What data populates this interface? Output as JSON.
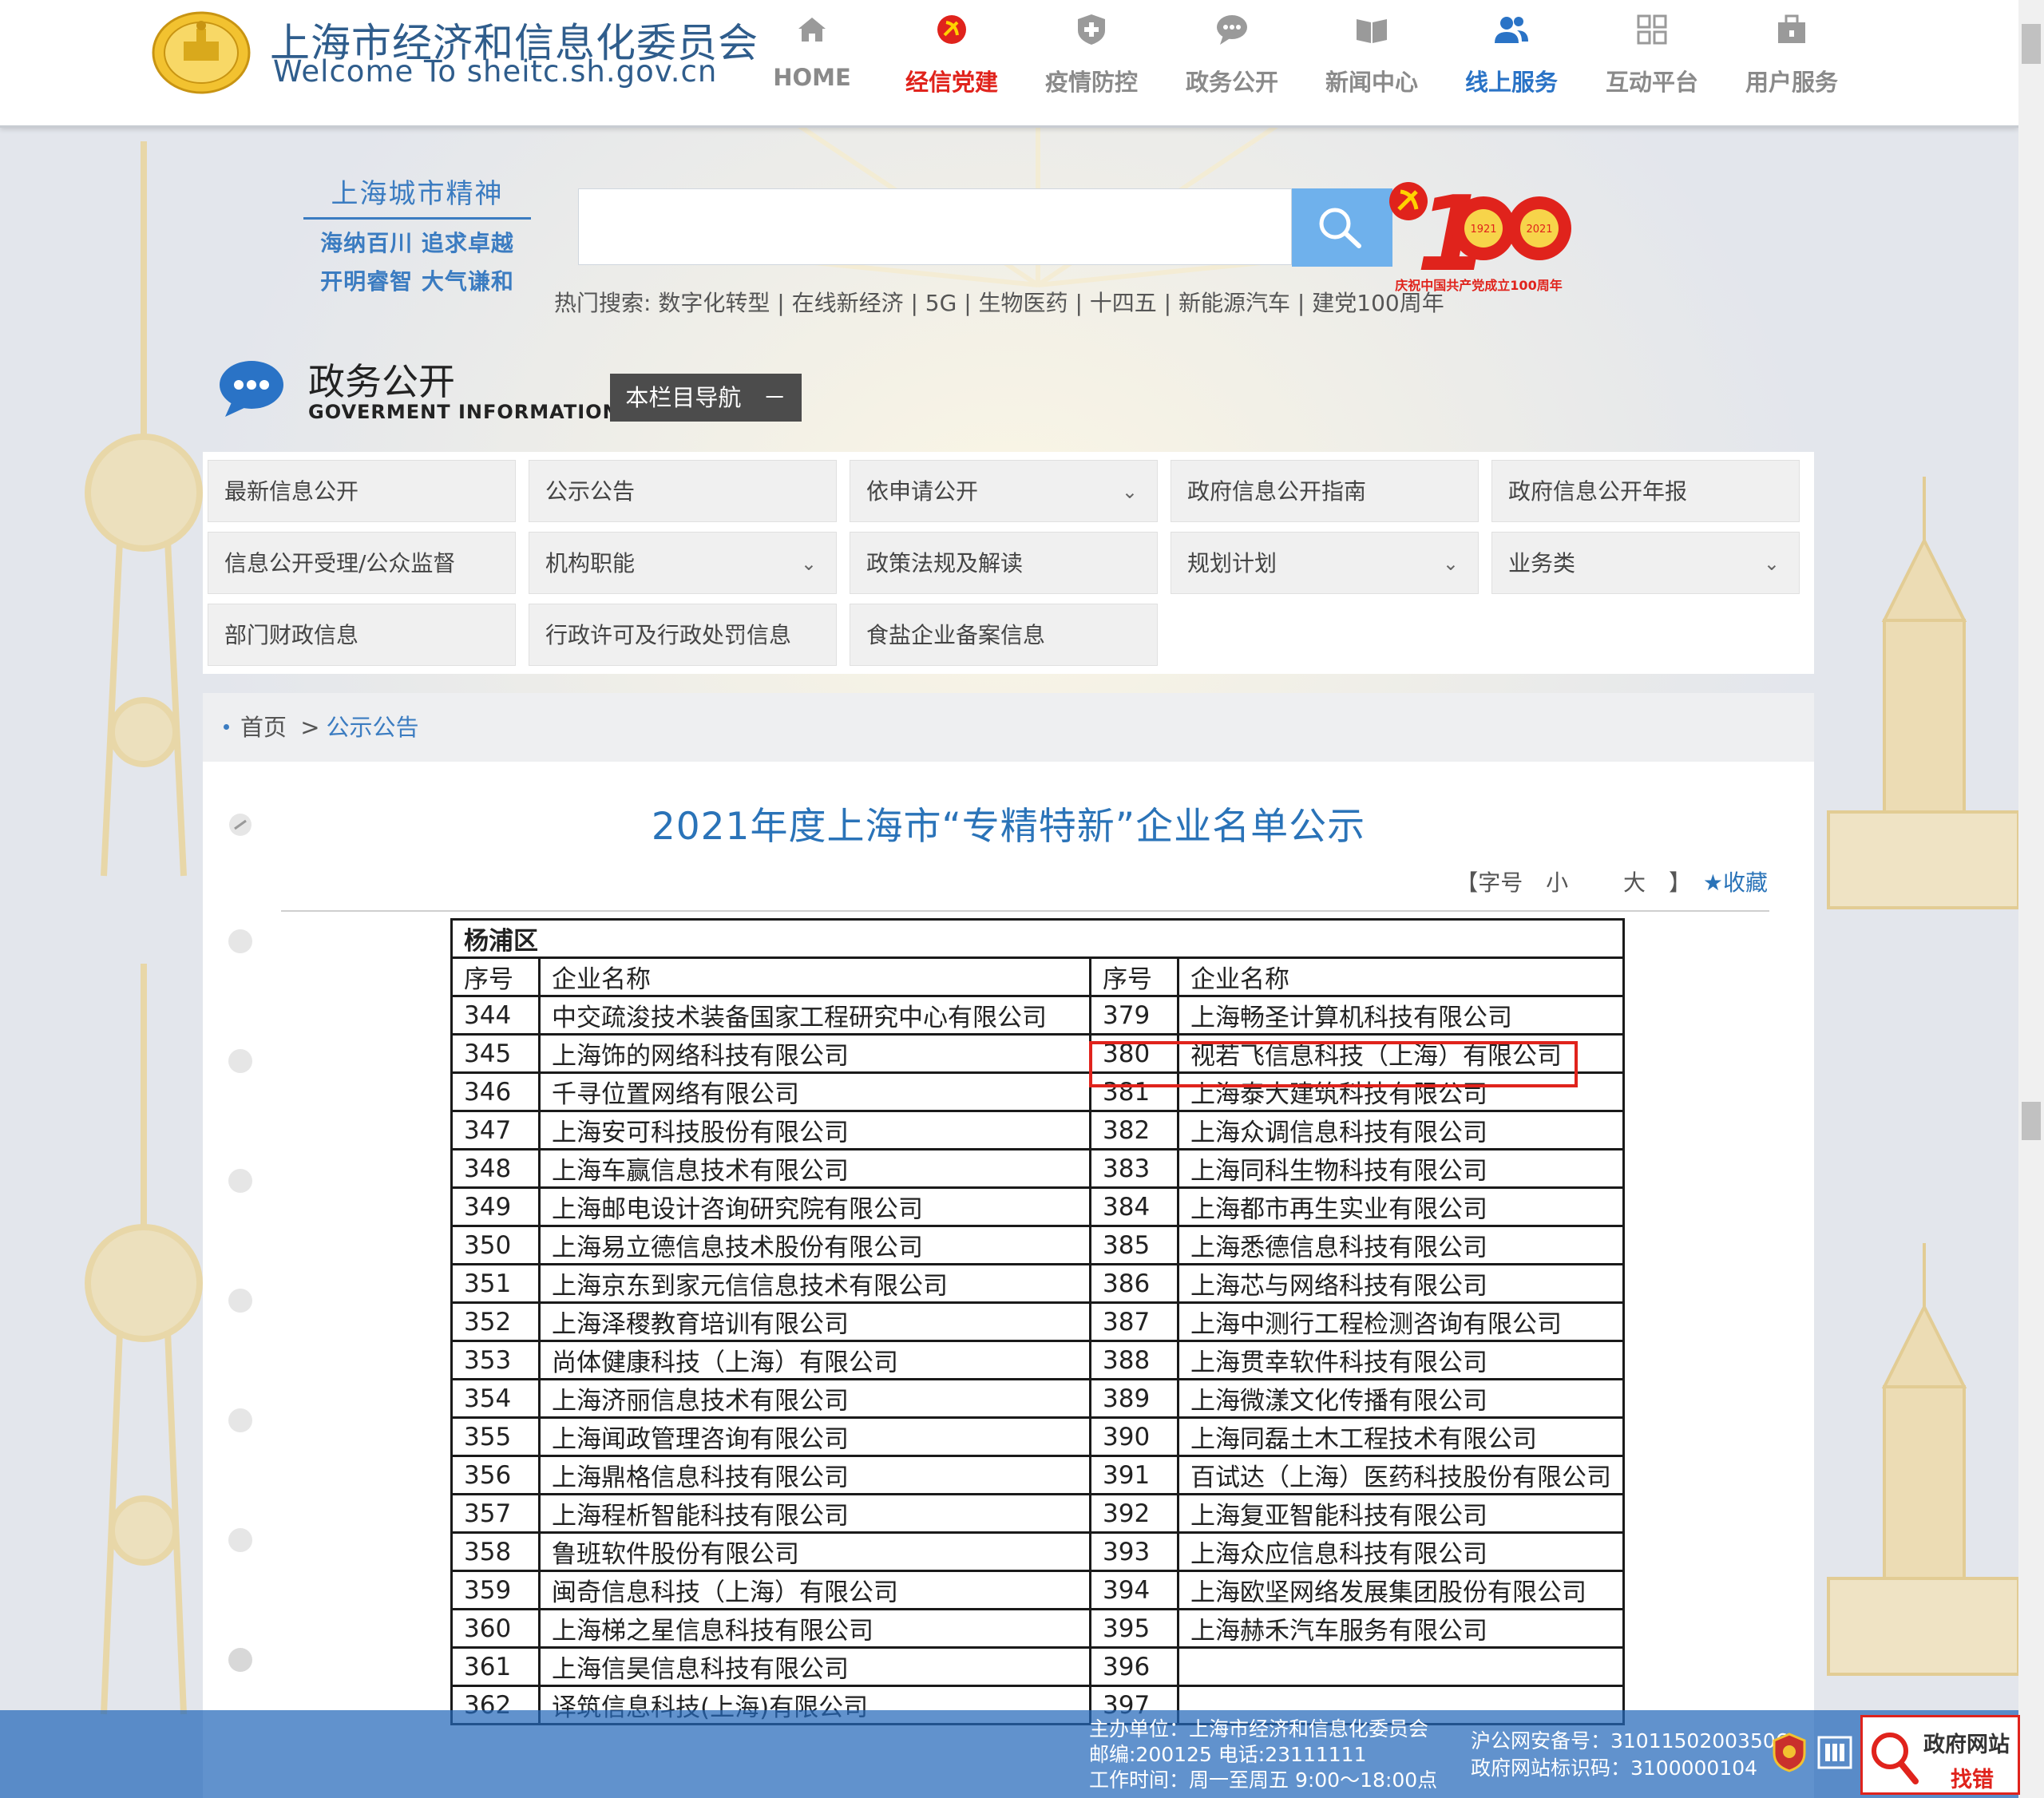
{
  "header": {
    "site_title": "上海市经济和信息化委员会",
    "site_subtitle": "Welcome To sheitc.sh.gov.cn",
    "nav": [
      {
        "label": "HOME",
        "icon": "home-icon"
      },
      {
        "label": "经信党建",
        "icon": "party-emblem-icon",
        "color": "#e0231c"
      },
      {
        "label": "疫情防控",
        "icon": "shield-cross-icon"
      },
      {
        "label": "政务公开",
        "icon": "chat-bubble-icon"
      },
      {
        "label": "新闻中心",
        "icon": "open-book-icon"
      },
      {
        "label": "线上服务",
        "icon": "users-icon",
        "color": "#2a73c6"
      },
      {
        "label": "互动平台",
        "icon": "grid-icon"
      },
      {
        "label": "用户服务",
        "icon": "briefcase-icon"
      }
    ]
  },
  "spirit": {
    "title": "上海城市精神",
    "line1": "海纳百川 追求卓越",
    "line2": "开明睿智 大气谦和"
  },
  "search": {
    "placeholder": "",
    "hot_search": "热门搜索: 数字化转型 | 在线新经济 | 5G | 生物医药 | 十四五 | 新能源汽车 | 建党100周年"
  },
  "anniversary_badge": {
    "text": "庆祝中国共产党成立100周年",
    "years": [
      "1921",
      "2021"
    ]
  },
  "section": {
    "title": "政务公开",
    "subtitle": "GOVERMENT INFORMATION",
    "column_nav_label": "本栏目导航",
    "column_nav_toggle": "－"
  },
  "menu": [
    {
      "label": "最新信息公开",
      "has_dropdown": false
    },
    {
      "label": "公示公告",
      "has_dropdown": false
    },
    {
      "label": "依申请公开",
      "has_dropdown": true
    },
    {
      "label": "政府信息公开指南",
      "has_dropdown": false
    },
    {
      "label": "政府信息公开年报",
      "has_dropdown": false
    },
    {
      "label": "信息公开受理/公众监督",
      "has_dropdown": false
    },
    {
      "label": "机构职能",
      "has_dropdown": true
    },
    {
      "label": "政策法规及解读",
      "has_dropdown": false
    },
    {
      "label": "规划计划",
      "has_dropdown": true
    },
    {
      "label": "业务类",
      "has_dropdown": true
    },
    {
      "label": "部门财政信息",
      "has_dropdown": false
    },
    {
      "label": "行政许可及行政处罚信息",
      "has_dropdown": false
    },
    {
      "label": "食盐企业备案信息",
      "has_dropdown": false
    }
  ],
  "breadcrumb": {
    "home": "首页",
    "separator": ">",
    "current": "公示公告"
  },
  "article": {
    "title": "2021年度上海市“专精特新”企业名单公示",
    "font_size_label": "【字号",
    "font_small": "小",
    "font_large": "大",
    "font_close": "】",
    "collect_label": "★收藏"
  },
  "table": {
    "district": "杨浦区",
    "headers": [
      "序号",
      "企业名称",
      "序号",
      "企业名称"
    ],
    "highlighted_no": "380",
    "rows": [
      [
        "344",
        "中交疏浚技术装备国家工程研究中心有限公司",
        "379",
        "上海畅圣计算机科技有限公司"
      ],
      [
        "345",
        "上海饰的网络科技有限公司",
        "380",
        "视若飞信息科技（上海）有限公司"
      ],
      [
        "346",
        "千寻位置网络有限公司",
        "381",
        "上海泰大建筑科技有限公司"
      ],
      [
        "347",
        "上海安可科技股份有限公司",
        "382",
        "上海众调信息科技有限公司"
      ],
      [
        "348",
        "上海车赢信息技术有限公司",
        "383",
        "上海同科生物科技有限公司"
      ],
      [
        "349",
        "上海邮电设计咨询研究院有限公司",
        "384",
        "上海都市再生实业有限公司"
      ],
      [
        "350",
        "上海易立德信息技术股份有限公司",
        "385",
        "上海悉德信息科技有限公司"
      ],
      [
        "351",
        "上海京东到家元信信息技术有限公司",
        "386",
        "上海芯与网络科技有限公司"
      ],
      [
        "352",
        "上海泽稷教育培训有限公司",
        "387",
        "上海中测行工程检测咨询有限公司"
      ],
      [
        "353",
        "尚体健康科技（上海）有限公司",
        "388",
        "上海贯幸软件科技有限公司"
      ],
      [
        "354",
        "上海济丽信息技术有限公司",
        "389",
        "上海微漾文化传播有限公司"
      ],
      [
        "355",
        "上海闻政管理咨询有限公司",
        "390",
        "上海同磊土木工程技术有限公司"
      ],
      [
        "356",
        "上海鼎格信息科技有限公司",
        "391",
        "百试达（上海）医药科技股份有限公司"
      ],
      [
        "357",
        "上海程析智能科技有限公司",
        "392",
        "上海复亚智能科技有限公司"
      ],
      [
        "358",
        "鲁班软件股份有限公司",
        "393",
        "上海众应信息科技有限公司"
      ],
      [
        "359",
        "闽奇信息科技（上海）有限公司",
        "394",
        "上海欧坚网络发展集团股份有限公司"
      ],
      [
        "360",
        "上海梯之星信息科技有限公司",
        "395",
        "上海赫禾汽车服务有限公司"
      ],
      [
        "361",
        "上海信昊信息科技有限公司",
        "396",
        ""
      ],
      [
        "362",
        "译筑信息科技(上海)有限公司",
        "397",
        ""
      ]
    ]
  },
  "footer": {
    "host_line": "主办单位：上海市经济和信息化委员会",
    "postal_line": "邮编:200125 电话:23111111",
    "hours_line": "工作时间：周一至周五 9:00～18:00点",
    "icp": "沪公网安备号：31011502003506",
    "site_id": "政府网站标识码：3100000104",
    "error_finder_title": "政府网站",
    "error_finder_sub": "找错"
  },
  "colors": {
    "brand_blue": "#2f5d8c",
    "accent_red": "#e0231c",
    "link_blue": "#2a73b8",
    "footer_blue": "#2468ba"
  }
}
